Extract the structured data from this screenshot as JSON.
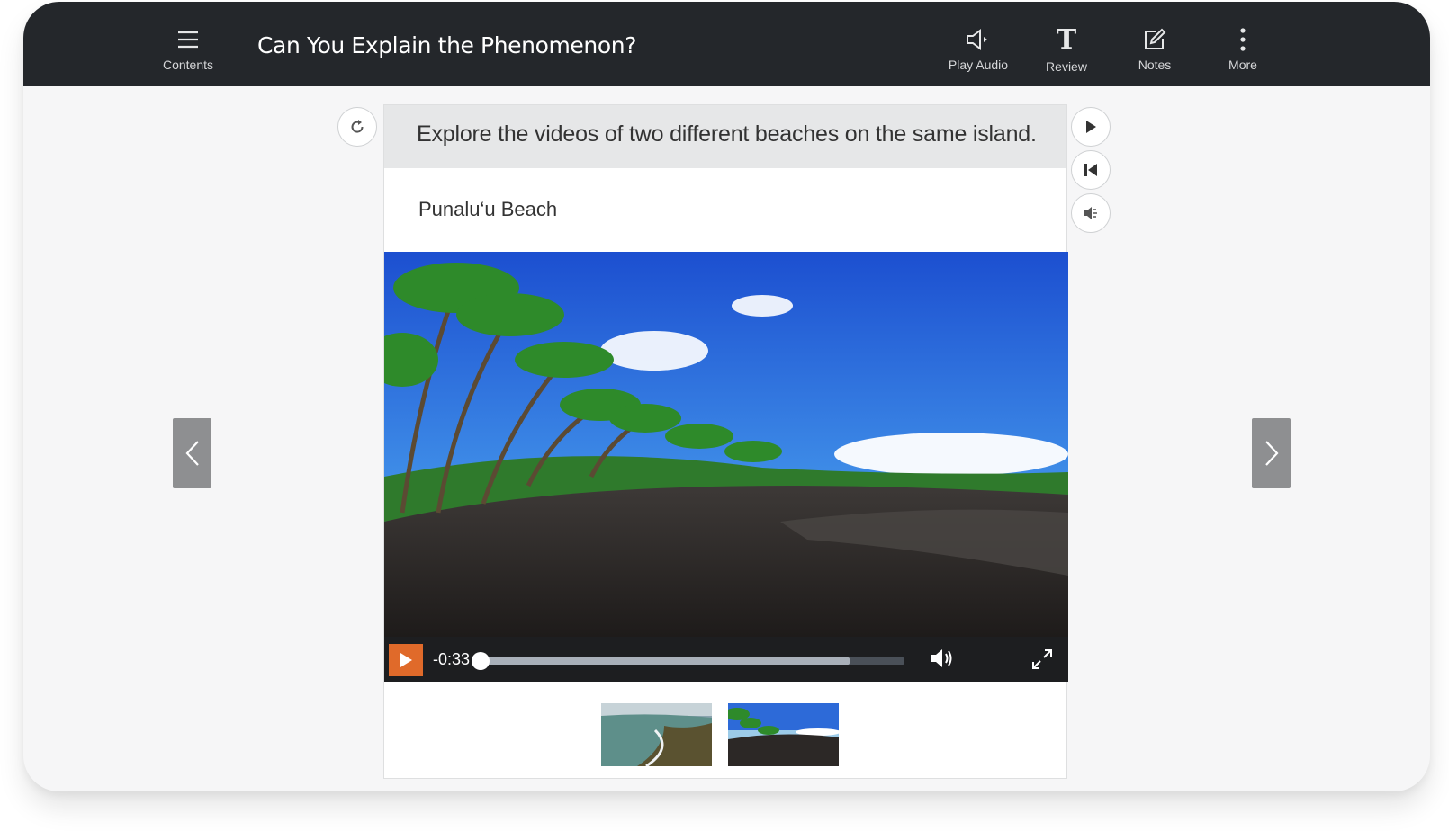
{
  "topbar": {
    "title": "Can You Explain the Phenomenon?",
    "contents_label": "Contents",
    "play_audio_label": "Play Audio",
    "review_label": "Review",
    "notes_label": "Notes",
    "more_label": "More"
  },
  "panel": {
    "instruction": "Explore the videos of two different beaches on the same island.",
    "beach_label": "Punalu‘u Beach"
  },
  "player": {
    "time": "-0:33",
    "progress_buffered": 0.87,
    "accent_color": "#e06a2a"
  },
  "thumbnails": [
    {
      "name": "green-sand-beach-thumbnail",
      "selected": false
    },
    {
      "name": "punaluu-beach-thumbnail",
      "selected": true
    }
  ],
  "icons": [
    "menu-icon",
    "speaker-icon",
    "text-icon",
    "notes-icon",
    "more-vertical-icon",
    "reset-icon",
    "play-icon",
    "restart-icon",
    "audio-icon",
    "volume-icon",
    "fullscreen-icon",
    "chevron-left-icon",
    "chevron-right-icon"
  ]
}
